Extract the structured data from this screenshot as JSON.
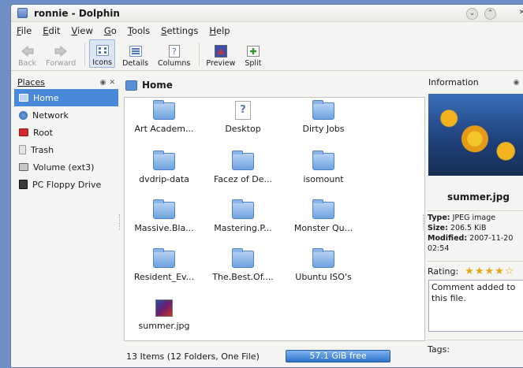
{
  "window": {
    "title": "ronnie - Dolphin"
  },
  "menubar": {
    "items": [
      "File",
      "Edit",
      "View",
      "Go",
      "Tools",
      "Settings",
      "Help"
    ],
    "underline": [
      "F",
      "E",
      "V",
      "G",
      "T",
      "S",
      "H"
    ]
  },
  "toolbar": {
    "back": "Back",
    "forward": "Forward",
    "icons": "Icons",
    "details": "Details",
    "columns": "Columns",
    "preview": "Preview",
    "split": "Split"
  },
  "places": {
    "title": "Places",
    "items": [
      "Home",
      "Network",
      "Root",
      "Trash",
      "Volume (ext3)",
      "PC Floppy Drive"
    ]
  },
  "main": {
    "location": "Home",
    "files": [
      {
        "name": "Art Academ...",
        "kind": "folder-icon"
      },
      {
        "name": "Desktop",
        "kind": "document-icon"
      },
      {
        "name": "Dirty Jobs",
        "kind": "folder-icon"
      },
      {
        "name": "dvdrip-data",
        "kind": "folder-icon"
      },
      {
        "name": "Facez of De...",
        "kind": "folder-icon"
      },
      {
        "name": "isomount",
        "kind": "folder-icon"
      },
      {
        "name": "Massive.Bla...",
        "kind": "folder-icon"
      },
      {
        "name": "Mastering.P...",
        "kind": "folder-icon"
      },
      {
        "name": "Monster Qu...",
        "kind": "folder-icon"
      },
      {
        "name": "Resident_Ev...",
        "kind": "folder-icon"
      },
      {
        "name": "The.Best.Of....",
        "kind": "folder-icon"
      },
      {
        "name": "Ubuntu ISO's",
        "kind": "folder-icon"
      },
      {
        "name": "summer.jpg",
        "kind": "image-icon"
      }
    ],
    "status": "13 Items (12 Folders, One File)",
    "free_space": "57.1 GiB free"
  },
  "info": {
    "title": "Information",
    "filename": "summer.jpg",
    "type_label": "Type:",
    "type_value": "JPEG image",
    "size_label": "Size:",
    "size_value": "206.5 KiB",
    "modified_label": "Modified:",
    "modified_value": "2007-11-20 02:54",
    "rating_label": "Rating:",
    "rating": 4,
    "comment": "Comment added to this file.",
    "tags_label": "Tags:"
  }
}
